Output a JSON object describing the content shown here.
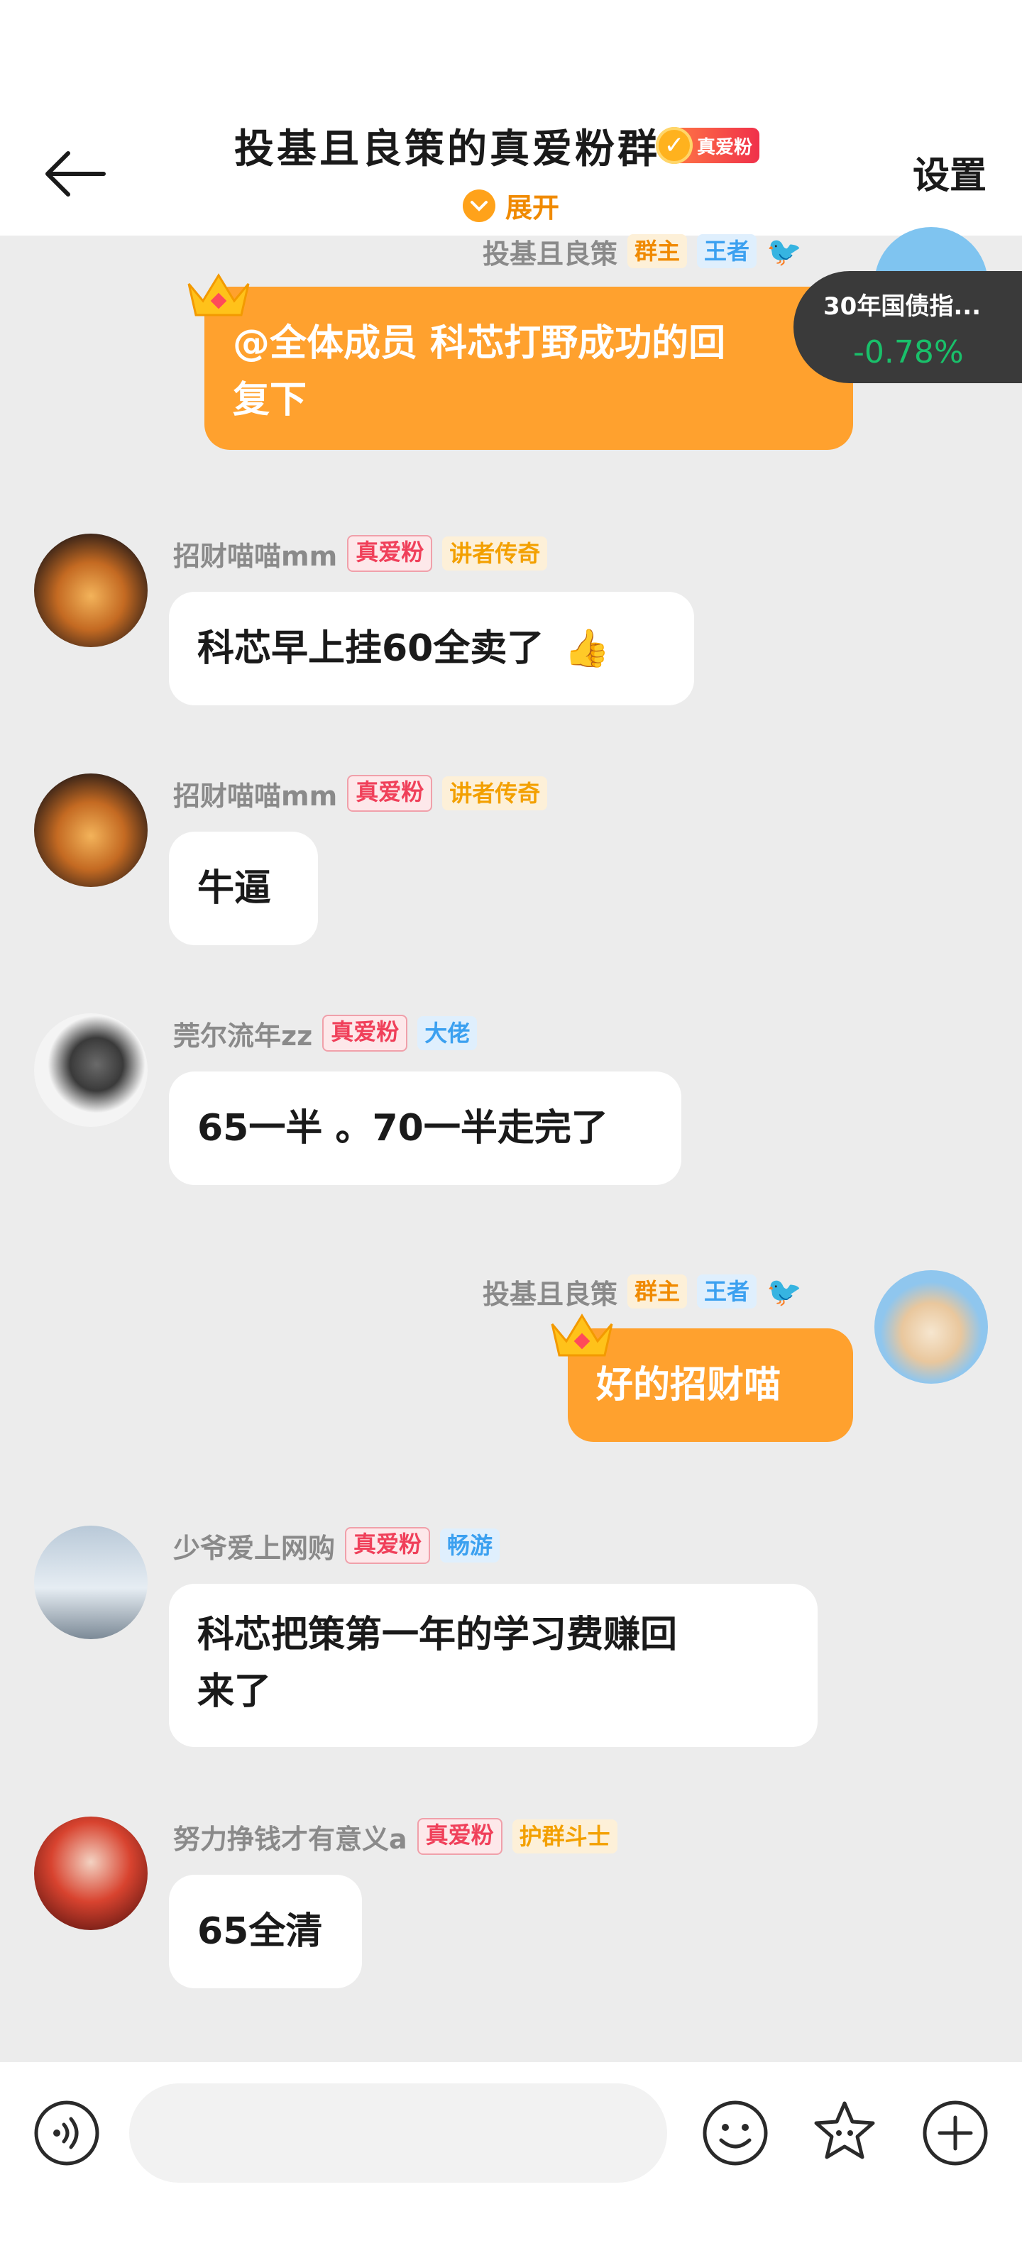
{
  "header": {
    "title": "投基且良策的真爱粉群",
    "title_badge": "真爱粉",
    "settings_label": "设置",
    "expand_label": "展开"
  },
  "ticker": {
    "name": "30年国债指...",
    "value": "-0.78%"
  },
  "messages": [
    {
      "sender": "投基且良策",
      "tags": [
        "群主",
        "王者"
      ],
      "text": "@全体成员 科芯打野成功的回复下",
      "line1": "@全体成员 科芯打野成功的回",
      "line2": "复下",
      "self": true
    },
    {
      "sender": "招财喵喵mm",
      "tags": [
        "真爱粉",
        "讲者传奇"
      ],
      "text": "科芯早上挂60全卖了",
      "emoji": "👍"
    },
    {
      "sender": "招财喵喵mm",
      "tags": [
        "真爱粉",
        "讲者传奇"
      ],
      "text": "牛逼"
    },
    {
      "sender": "莞尔流年zz",
      "tags": [
        "真爱粉",
        "大佬"
      ],
      "text": "65一半 。70一半走完了"
    },
    {
      "sender": "投基且良策",
      "tags": [
        "群主",
        "王者"
      ],
      "text": "好的招财喵",
      "self": true
    },
    {
      "sender": "少爷爱上网购",
      "tags": [
        "真爱粉",
        "畅游"
      ],
      "line1": "科芯把策第一年的学习费赚回",
      "line2": "来了"
    },
    {
      "sender": "努力挣钱才有意义a",
      "tags": [
        "真爱粉",
        "护群斗士"
      ],
      "text": "65全清"
    }
  ],
  "colors": {
    "accent": "#ffa12e",
    "fan_tag": "#f0405a",
    "ticker_change": "#19c06a"
  },
  "bottom_bar": {
    "icons": [
      "voice-icon",
      "emoji-icon",
      "sticker-icon",
      "plus-icon"
    ]
  }
}
